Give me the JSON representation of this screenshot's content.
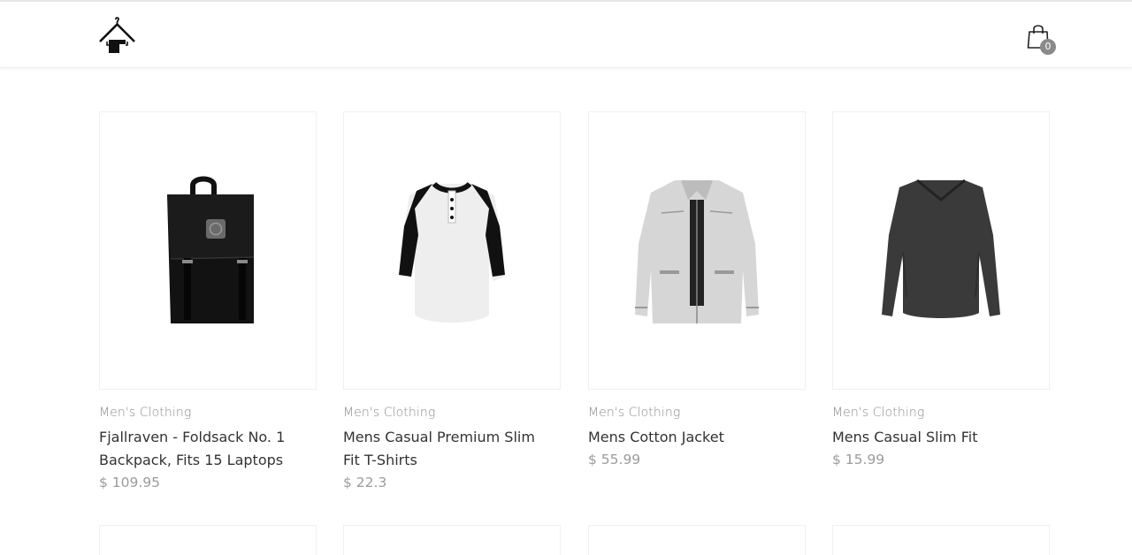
{
  "header": {
    "logo_icon": "hanger-house-logo-icon",
    "cart_icon": "shopping-bag-icon",
    "cart_count": "0"
  },
  "products": [
    {
      "category": "Men's Clothing",
      "title": "Fjallraven - Foldsack No. 1 Backpack, Fits 15 Laptops",
      "price": "$ 109.95",
      "image": "backpack-image"
    },
    {
      "category": "Men's Clothing",
      "title": "Mens Casual Premium Slim Fit T-Shirts",
      "price": "$ 22.3",
      "image": "raglan-tshirt-image"
    },
    {
      "category": "Men's Clothing",
      "title": "Mens Cotton Jacket",
      "price": "$ 55.99",
      "image": "cotton-jacket-image"
    },
    {
      "category": "Men's Clothing",
      "title": "Mens Casual Slim Fit",
      "price": "$ 15.99",
      "image": "slim-fit-longsleeve-image"
    }
  ],
  "colors": {
    "text": "#333333",
    "muted": "#8b8b8b",
    "badge": "#8a8a8a"
  }
}
